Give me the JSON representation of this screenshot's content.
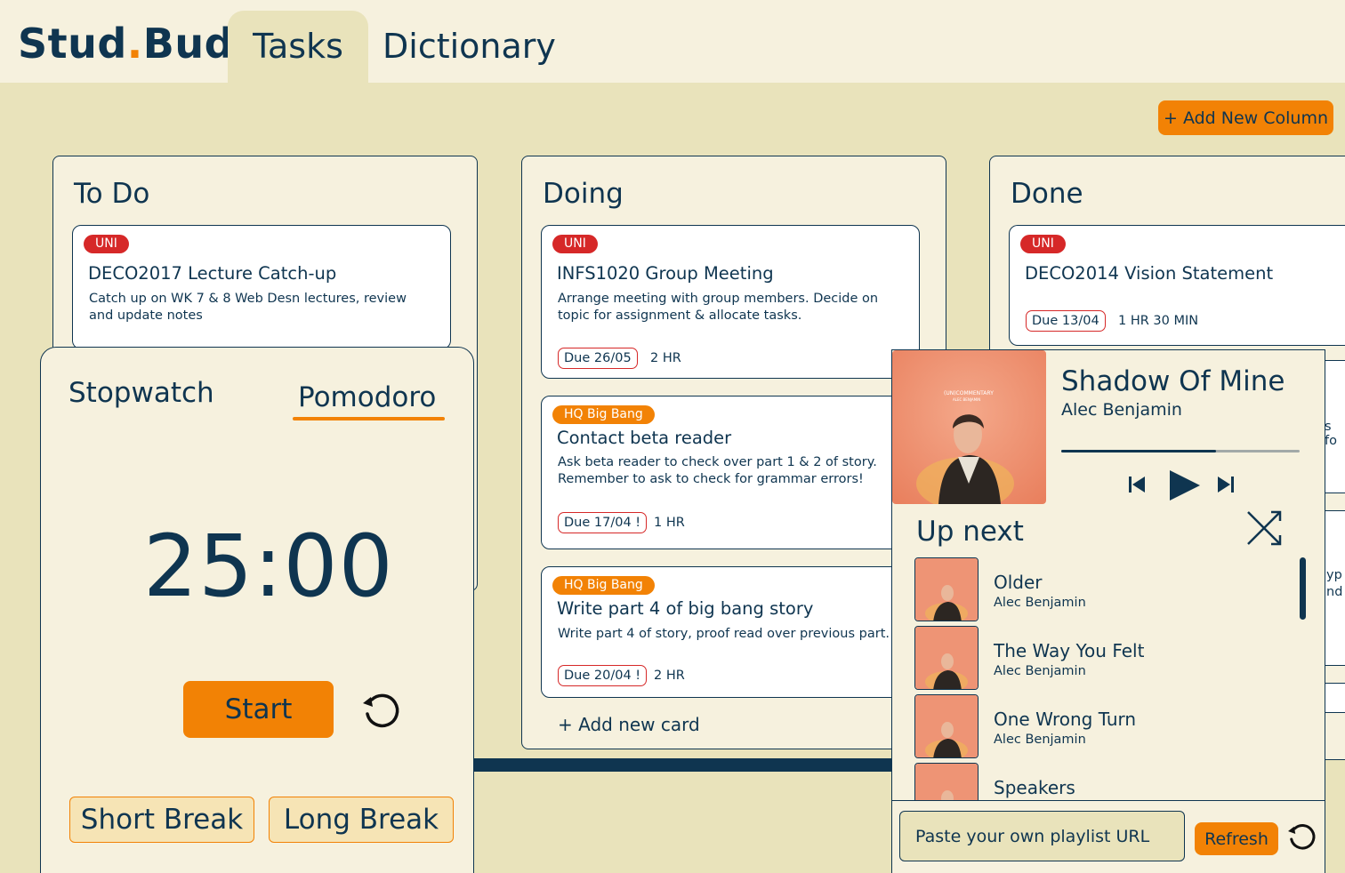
{
  "header": {
    "logo_a": "Stud",
    "logo_dot": ".",
    "logo_b": "Bud",
    "tabs": [
      "Tasks",
      "Dictionary"
    ]
  },
  "toolbar": {
    "add_column": "+ Add New Column"
  },
  "columns": [
    {
      "title": "To Do",
      "cards": [
        {
          "tag": "UNI",
          "title": "DECO2017 Lecture Catch-up",
          "desc": "Catch up on WK 7 & 8 Web Desn lectures, review and update notes"
        }
      ]
    },
    {
      "title": "Doing",
      "cards": [
        {
          "tag": "UNI",
          "title": "INFS1020 Group Meeting",
          "desc": "Arrange meeting with group members. Decide on topic for assignment & allocate tasks.",
          "due": "Due 26/05",
          "dur": "2 HR"
        },
        {
          "tag": "HQ Big Bang",
          "title": "Contact beta reader",
          "desc": "Ask beta reader to check over part 1 & 2 of story. Remember to ask to check for grammar errors!",
          "due": "Due 17/04 !",
          "dur": "1 HR"
        },
        {
          "tag": "HQ Big Bang",
          "title": "Write part 4 of big bang story",
          "desc": "Write part 4 of story, proof read over previous part.",
          "due": "Due 20/04 !",
          "dur": "2 HR"
        }
      ],
      "add_card": "+ Add new card"
    },
    {
      "title": "Done",
      "cards": [
        {
          "tag": "UNI",
          "title": "DECO2014 Vision Statement",
          "due": "Due 13/04",
          "dur": "1 HR 30 MIN"
        }
      ],
      "partial_text_1": "s fo",
      "partial_text_2": "yp",
      "partial_text_3": "nd"
    }
  ],
  "timer": {
    "modes": [
      "Stopwatch",
      "Pomodoro"
    ],
    "active_mode": "Pomodoro",
    "time": "25:00",
    "start": "Start",
    "breaks": [
      "Short Break",
      "Long Break"
    ]
  },
  "music": {
    "album_text": "(UN)COMMENTARY",
    "album_subtext": "ALEC BENJAMIN",
    "now_playing": {
      "title": "Shadow Of Mine",
      "artist": "Alec Benjamin",
      "progress": 0.65
    },
    "up_next_label": "Up next",
    "queue": [
      {
        "title": "Older",
        "artist": "Alec Benjamin"
      },
      {
        "title": "The Way You Felt",
        "artist": "Alec Benjamin"
      },
      {
        "title": "One Wrong Turn",
        "artist": "Alec Benjamin"
      },
      {
        "title": "Speakers",
        "artist": ""
      }
    ],
    "url_placeholder": "Paste your own playlist URL",
    "refresh": "Refresh"
  },
  "colors": {
    "accent": "#f28205",
    "navy": "#0f3550",
    "bg": "#e9e3bb",
    "panel": "#f6f1de",
    "due_red": "#d62828"
  }
}
